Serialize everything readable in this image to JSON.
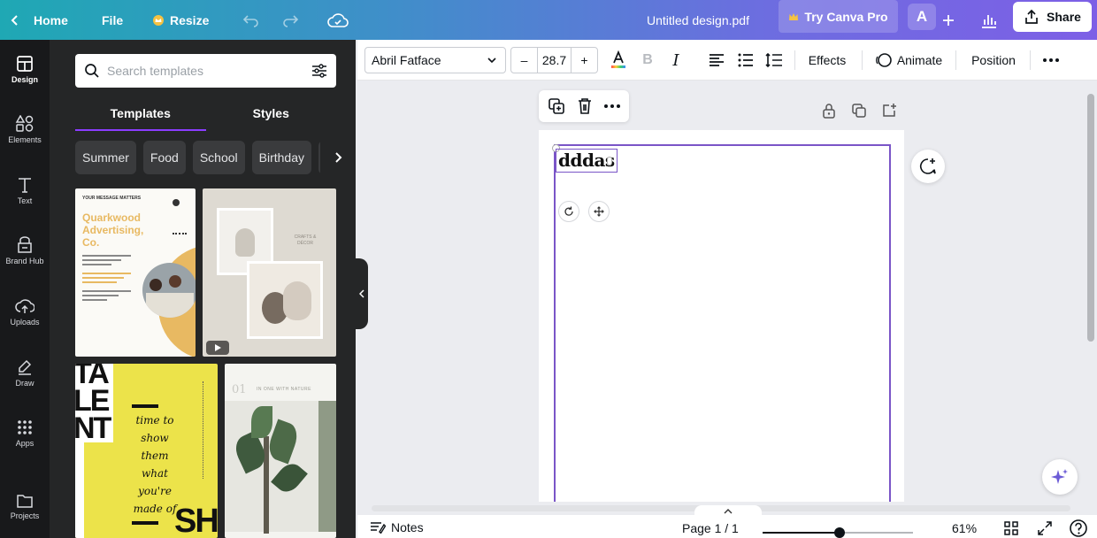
{
  "topbar": {
    "home_label": "Home",
    "file_label": "File",
    "resize_label": "Resize",
    "doc_title": "Untitled design.pdf",
    "try_pro_label": "Try Canva Pro",
    "avatar_letter": "A",
    "share_label": "Share"
  },
  "rail": {
    "items": [
      {
        "label": "Design",
        "icon": "layout-icon"
      },
      {
        "label": "Elements",
        "icon": "shapes-icon"
      },
      {
        "label": "Text",
        "icon": "text-icon"
      },
      {
        "label": "Brand Hub",
        "icon": "brand-icon"
      },
      {
        "label": "Uploads",
        "icon": "cloud-upload-icon"
      },
      {
        "label": "Draw",
        "icon": "pen-icon"
      },
      {
        "label": "Apps",
        "icon": "grid-icon"
      },
      {
        "label": "Projects",
        "icon": "folder-icon"
      }
    ]
  },
  "panel": {
    "search_placeholder": "Search templates",
    "tabs": [
      "Templates",
      "Styles"
    ],
    "chips": [
      "Summer",
      "Food",
      "School",
      "Birthday"
    ],
    "templates": {
      "t1": {
        "kicker": "YOUR MESSAGE MATTERS",
        "title_line1": "Quarkwood",
        "title_line2": "Advertising,",
        "title_line3": "Co."
      },
      "t2": {
        "brand": "CRAFTS & DÉCOR"
      },
      "t3": {
        "big1": "TA",
        "big2": "LE",
        "big3": "NT",
        "line1": "time to",
        "line2": "show",
        "line3": "them",
        "line4": "what",
        "line5": "you're",
        "line6": "made of",
        "big_bottom": "SH"
      },
      "t4": {
        "number": "01",
        "caption": "IN ONE WITH NATURE"
      }
    }
  },
  "toolbar": {
    "font_name": "Abril Fatface",
    "font_size": "28.7",
    "effects_label": "Effects",
    "animate_label": "Animate",
    "position_label": "Position"
  },
  "canvas": {
    "text_content": "dddas"
  },
  "footer": {
    "notes_label": "Notes",
    "page_label": "Page 1 / 1",
    "zoom_label": "61%",
    "zoom_fraction": 0.51
  },
  "colors": {
    "accent": "#8b3dff",
    "selection": "#7a55c7",
    "panel_bg": "#252627",
    "rail_bg": "#18191b"
  }
}
